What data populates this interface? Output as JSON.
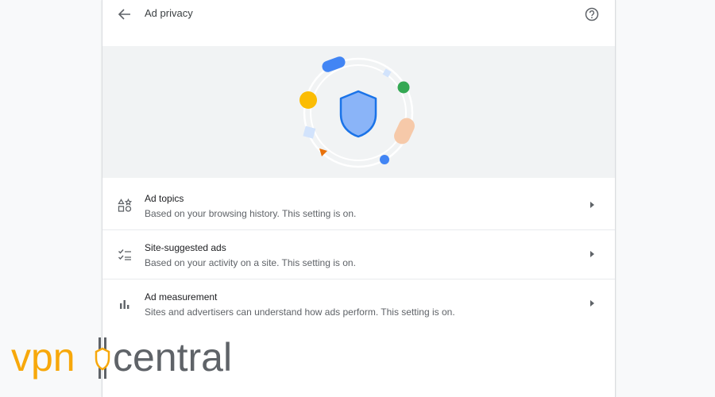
{
  "header": {
    "title": "Ad privacy",
    "back_icon": "arrow-back-icon",
    "help_icon": "help-circle-icon"
  },
  "banner": {
    "illustration": "shield-illustration"
  },
  "rows": [
    {
      "icon": "shapes-icon",
      "title": "Ad topics",
      "subtitle": "Based on your browsing history. This setting is on."
    },
    {
      "icon": "checklist-icon",
      "title": "Site-suggested ads",
      "subtitle": "Based on your activity on a site. This setting is on."
    },
    {
      "icon": "bar-chart-icon",
      "title": "Ad measurement",
      "subtitle": "Sites and advertisers can understand how ads perform. This setting is on."
    }
  ],
  "watermark": {
    "part1": "vpn",
    "part2": "central"
  },
  "colors": {
    "shield_fill": "#8ab4f8",
    "shield_stroke": "#1a73e8",
    "banner_bg": "#f1f3f4",
    "watermark_orange": "#f7a80b",
    "watermark_gray": "#5f6368"
  }
}
